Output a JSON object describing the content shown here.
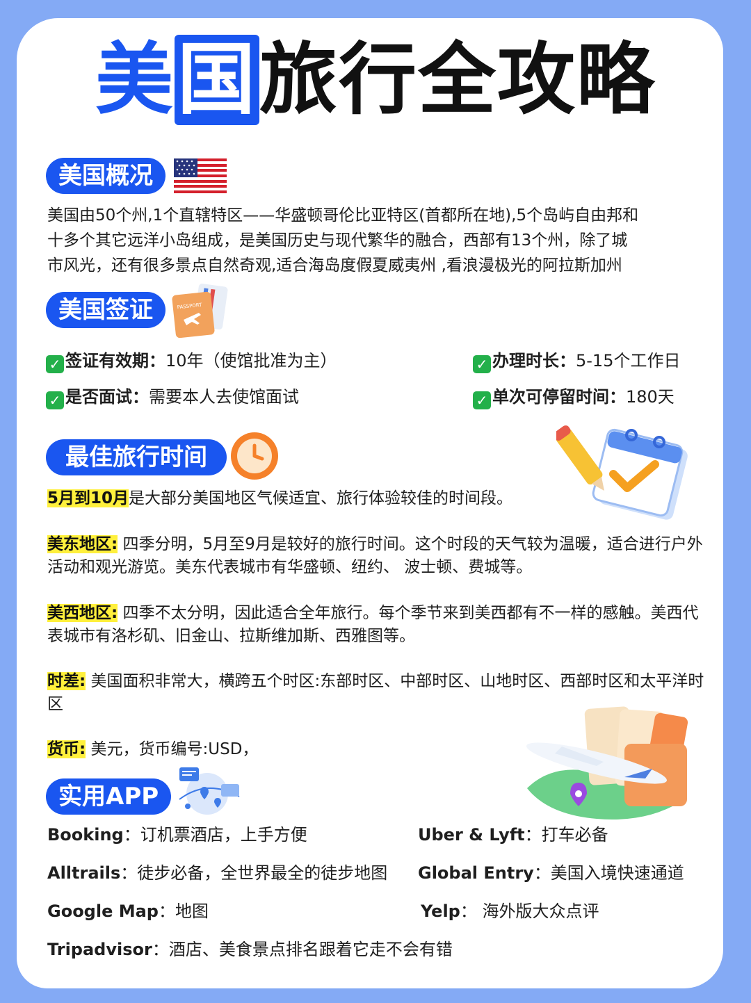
{
  "title": {
    "part1": "美",
    "part2": "国",
    "part3": "旅行全攻略"
  },
  "overview": {
    "heading": "美国概况",
    "lines": [
      "美国由50个州,1个直辖特区——华盛顿哥伦比亚特区(首都所在地),5个岛屿自由邦和",
      "十多个其它远洋小岛组成，是美国历史与现代繁华的融合，西部有13个州，除了城",
      "市风光，还有很多景点自然奇观,适合海岛度假夏威夷州 ,看浪漫极光的阿拉斯加州"
    ]
  },
  "visa": {
    "heading": "美国签证",
    "passport_text": "PASSPORT",
    "items": [
      {
        "label": "签证有效期：",
        "value": "10年（使馆批准为主）"
      },
      {
        "label": "办理时长：",
        "value": "5-15个工作日"
      },
      {
        "label": "是否面试：",
        "value": "需要本人去使馆面试"
      },
      {
        "label": "单次可停留时间：",
        "value": "180天"
      }
    ]
  },
  "best_time": {
    "heading": "最佳旅行时间",
    "intro_highlight": "5月到10月",
    "intro_text": "是大部分美国地区气候适宜、旅行体验较佳的时间段。",
    "east_label": "美东地区:",
    "east_text": " 四季分明，5月至9月是较好的旅行时间。这个时段的天气较为温暖，适合进行户外活动和观光游览。美东代表城市有华盛顿、纽约、 波士顿、费城等。",
    "west_label": "美西地区:",
    "west_text": " 四季不太分明，因此适合全年旅行。每个季节来到美西都有不一样的感触。美西代表城市有洛杉矶、旧金山、拉斯维加斯、西雅图等。",
    "tz_label": "时差:",
    "tz_text": " 美国面积非常大，横跨五个时区:东部时区、中部时区、山地时区、西部时区和太平洋时区",
    "currency_label": "货币:",
    "currency_text": " 美元，货币编号:USD，"
  },
  "apps": {
    "heading": "实用APP",
    "items": [
      {
        "name": "Booking",
        "desc": "：订机票酒店，上手方便"
      },
      {
        "name": "Uber & Lyft",
        "desc": "：打车必备"
      },
      {
        "name": "Alltrails",
        "desc": "：徒步必备，全世界最全的徒步地图"
      },
      {
        "name": "Global Entry",
        "desc": "：美国入境快速通道"
      },
      {
        "name": "Google Map",
        "desc": "：地图"
      },
      {
        "name": "Yelp",
        "desc": "： 海外版大众点评"
      },
      {
        "name": "Tripadvisor",
        "desc": "：酒店、美食景点排名跟着它走不会有错"
      }
    ]
  },
  "colors": {
    "brand_blue": "#1a56f0",
    "highlight": "#fff03c",
    "background": "#84aaf5",
    "check_green": "#23b04a"
  },
  "icons": [
    "us-flag-icon",
    "passport-icon",
    "clock-icon",
    "calendar-pencil-icon",
    "map-pins-icon",
    "airplane-tickets-icon",
    "check-icon"
  ]
}
